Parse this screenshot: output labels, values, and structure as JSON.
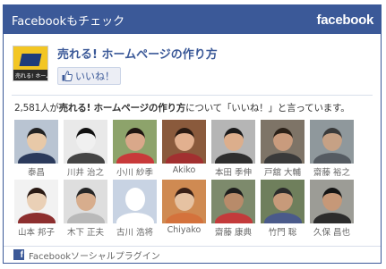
{
  "header": {
    "title": "Facebookもチェック",
    "logo": "facebook",
    "background": "#3b5998"
  },
  "page": {
    "name": "売れる! ホームページの作り方",
    "thumb_icon": "yellow-logo-thumbnail",
    "thumb_caption": "売れる! ホームページの作り方"
  },
  "like_button": {
    "label": "いいね！",
    "icon": "thumbs-up-icon"
  },
  "summary": {
    "count_text": "2,581人が",
    "page_name": "売れる! ホームページの作り方",
    "suffix": "について「いいね！」と言っています。"
  },
  "faces": [
    {
      "name": "泰昌",
      "skin": "#e8c9a8",
      "hair": "#222222",
      "bg": "#b9c4d2",
      "shirt": "#2b3a5c"
    },
    {
      "name": "川井 治之",
      "skin": "#f0f0f0",
      "hair": "#111111",
      "bg": "#e9e9e9",
      "shirt": "#444444"
    },
    {
      "name": "小川 紗季",
      "skin": "#d9a88a",
      "hair": "#1e1410",
      "bg": "#8da36b",
      "shirt": "#c83a3a"
    },
    {
      "name": "Akiko",
      "skin": "#e2b08f",
      "hair": "#2a1a12",
      "bg": "#8a5a3c",
      "shirt": "#a23030"
    },
    {
      "name": "本田 季伸",
      "skin": "#dcae8c",
      "hair": "#1b1b1b",
      "bg": "#b5b5b5",
      "shirt": "#2e2e2e"
    },
    {
      "name": "戸舘 大輔",
      "skin": "#c99b7d",
      "hair": "#2b2118",
      "bg": "#7e7467",
      "shirt": "#3a3a3a"
    },
    {
      "name": "齋藤 裕之",
      "skin": "#c6a185",
      "hair": "#3a3a3a",
      "bg": "#8f989c",
      "shirt": "#555b62"
    },
    {
      "name": "山本 邦子",
      "skin": "#ead0b6",
      "hair": "#2a1a14",
      "bg": "#f2f2f2",
      "shirt": "#8d2f2f"
    },
    {
      "name": "木下 正夫",
      "skin": "#d7ad8d",
      "hair": "#262626",
      "bg": "#dedede",
      "shirt": "#b9b9b9"
    },
    {
      "name": "古川 浩将",
      "skin": "",
      "hair": "",
      "bg": "#c8d3e3",
      "shirt": "",
      "default": true
    },
    {
      "name": "Chiyako",
      "skin": "#e6c2a2",
      "hair": "#3a2016",
      "bg": "#cf8a52",
      "shirt": "#d4723c"
    },
    {
      "name": "齋藤 康典",
      "skin": "#b88b6a",
      "hair": "#1d1d1d",
      "bg": "#7d8a6c",
      "shirt": "#c33b3b"
    },
    {
      "name": "竹門 聡",
      "skin": "#c79a7a",
      "hair": "#2b2b2b",
      "bg": "#6f7f5c",
      "shirt": "#4a5a8a"
    },
    {
      "name": "久保 昌也",
      "skin": "#c69878",
      "hair": "#151515",
      "bg": "#9c9c96",
      "shirt": "#2c2c2c"
    }
  ],
  "footer": {
    "label": "Facebookソーシャルプラグイン",
    "icon": "facebook-f-icon"
  }
}
